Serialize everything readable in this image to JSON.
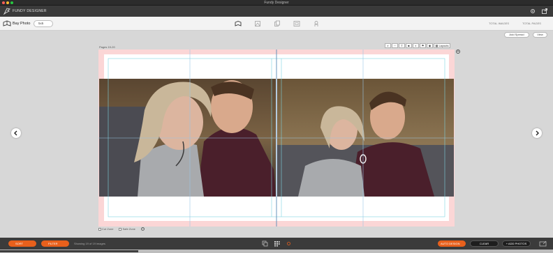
{
  "window": {
    "title": "Fundy Designer"
  },
  "app": {
    "brand": "FUNDY DESIGNER"
  },
  "subbar": {
    "album_name": "Bay Photo",
    "album_size": "5x5",
    "total_images_label": "TOTAL IMAGES",
    "total_pages_label": "TOTAL PAGES"
  },
  "actions": {
    "add_spread": "Add Spread",
    "view": "View"
  },
  "spread": {
    "pages_label": "Pages 19-20"
  },
  "toolbar": {
    "layouts": "Layouts",
    "text": "T"
  },
  "zones": {
    "cut_zone": "Cut Zone",
    "safe_zone": "Safe Zone"
  },
  "bottom": {
    "sort": "SORT",
    "filter": "FILTER",
    "showing": "Showing 19 of 19 images",
    "auto_design": "AUTO DESIGN",
    "clear": "CLEAR",
    "add_photos": "+ ADD PHOTOS"
  },
  "colors": {
    "accent": "#e8601c",
    "bleed": "#fbd6d6",
    "guide": "#7fd3e0"
  }
}
